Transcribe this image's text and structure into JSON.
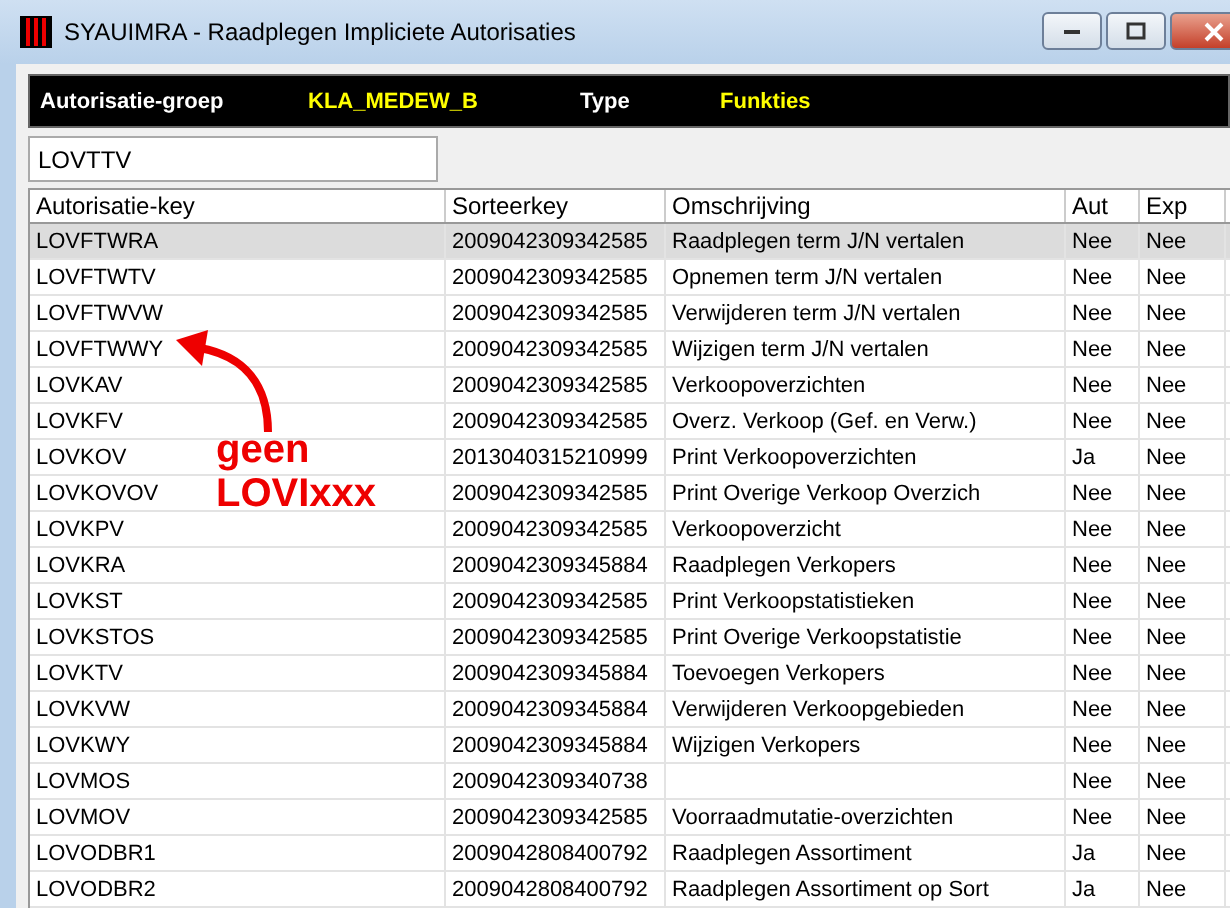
{
  "window": {
    "title": "SYAUIMRA - Raadplegen Impliciete Autorisaties"
  },
  "header": {
    "group_label": "Autorisatie-groep",
    "group_value": "KLA_MEDEW_B",
    "type_label": "Type",
    "type_value": "Funkties"
  },
  "filter": {
    "value": "LOVTTV"
  },
  "table": {
    "columns": [
      "Autorisatie-key",
      "Sorteerkey",
      "Omschrijving",
      "Aut",
      "Exp"
    ],
    "rows": [
      {
        "cells": [
          "LOVFTWRA",
          "2009042309342585",
          "Raadplegen term J/N vertalen",
          "Nee",
          "Nee"
        ],
        "selected": true
      },
      {
        "cells": [
          "LOVFTWTV",
          "2009042309342585",
          "Opnemen term J/N vertalen",
          "Nee",
          "Nee"
        ],
        "selected": false
      },
      {
        "cells": [
          "LOVFTWVW",
          "2009042309342585",
          "Verwijderen term J/N vertalen",
          "Nee",
          "Nee"
        ],
        "selected": false
      },
      {
        "cells": [
          "LOVFTWWY",
          "2009042309342585",
          "Wijzigen term J/N vertalen",
          "Nee",
          "Nee"
        ],
        "selected": false
      },
      {
        "cells": [
          "LOVKAV",
          "2009042309342585",
          "Verkoopoverzichten",
          "Nee",
          "Nee"
        ],
        "selected": false
      },
      {
        "cells": [
          "LOVKFV",
          "2009042309342585",
          "Overz. Verkoop (Gef. en Verw.)",
          "Nee",
          "Nee"
        ],
        "selected": false
      },
      {
        "cells": [
          "LOVKOV",
          "2013040315210999",
          "Print Verkoopoverzichten",
          "Ja",
          "Nee"
        ],
        "selected": false
      },
      {
        "cells": [
          "LOVKOVOV",
          "2009042309342585",
          "Print Overige Verkoop Overzich",
          "Nee",
          "Nee"
        ],
        "selected": false
      },
      {
        "cells": [
          "LOVKPV",
          "2009042309342585",
          "Verkoopoverzicht",
          "Nee",
          "Nee"
        ],
        "selected": false
      },
      {
        "cells": [
          "LOVKRA",
          "2009042309345884",
          "Raadplegen Verkopers",
          "Nee",
          "Nee"
        ],
        "selected": false
      },
      {
        "cells": [
          "LOVKST",
          "2009042309342585",
          "Print Verkoopstatistieken",
          "Nee",
          "Nee"
        ],
        "selected": false
      },
      {
        "cells": [
          "LOVKSTOS",
          "2009042309342585",
          "Print Overige Verkoopstatistie",
          "Nee",
          "Nee"
        ],
        "selected": false
      },
      {
        "cells": [
          "LOVKTV",
          "2009042309345884",
          "Toevoegen Verkopers",
          "Nee",
          "Nee"
        ],
        "selected": false
      },
      {
        "cells": [
          "LOVKVW",
          "2009042309345884",
          "Verwijderen Verkoopgebieden",
          "Nee",
          "Nee"
        ],
        "selected": false
      },
      {
        "cells": [
          "LOVKWY",
          "2009042309345884",
          "Wijzigen Verkopers",
          "Nee",
          "Nee"
        ],
        "selected": false
      },
      {
        "cells": [
          "LOVMOS",
          "2009042309340738",
          "",
          "Nee",
          "Nee"
        ],
        "selected": false
      },
      {
        "cells": [
          "LOVMOV",
          "2009042309342585",
          "Voorraadmutatie-overzichten",
          "Nee",
          "Nee"
        ],
        "selected": false
      },
      {
        "cells": [
          "LOVODBR1",
          "2009042808400792",
          "Raadplegen Assortiment",
          "Ja",
          "Nee"
        ],
        "selected": false
      },
      {
        "cells": [
          "LOVODBR2",
          "2009042808400792",
          "Raadplegen Assortiment op Sort",
          "Ja",
          "Nee"
        ],
        "selected": false
      }
    ]
  },
  "annotation": {
    "lines": [
      "geen",
      "LOVIxxx"
    ]
  }
}
